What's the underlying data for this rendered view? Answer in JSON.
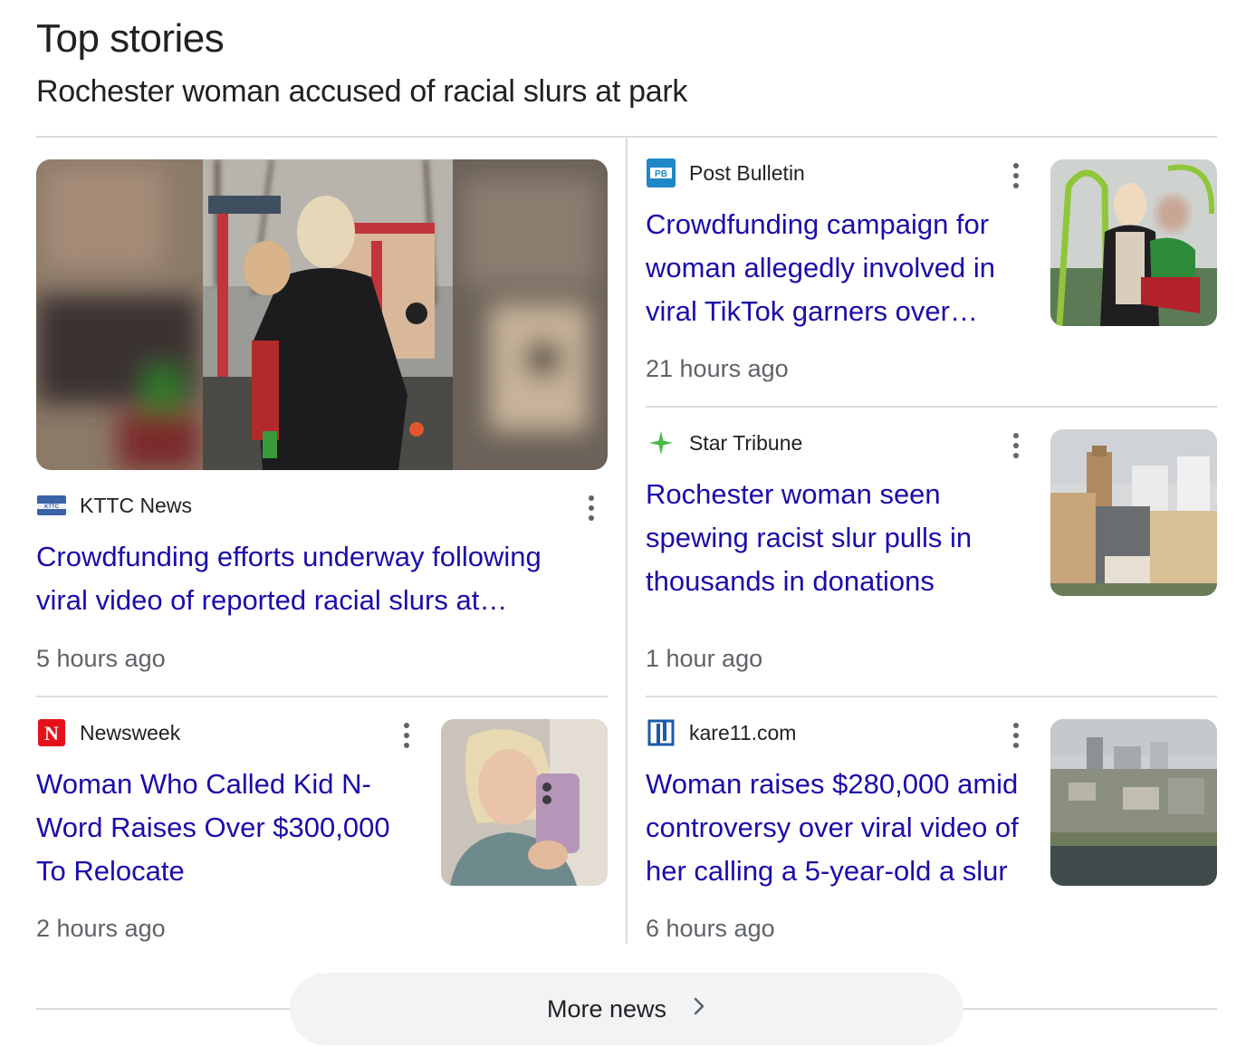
{
  "section": {
    "title": "Top stories",
    "subtitle": "Rochester woman accused of racial slurs at park"
  },
  "stories": [
    {
      "source": "KTTC News",
      "source_logo": "kttc-logo",
      "headline": "Crowdfunding efforts underway following viral video of reported racial slurs at…",
      "time": "5 hours ago",
      "image": "playground-woman-carrying-child"
    },
    {
      "source": "Post Bulletin",
      "source_logo": "pb-logo",
      "logo_text": "PB",
      "headline": "Crowdfunding campaign for woman allegedly involved in viral TikTok garners over…",
      "time": "21 hours ago",
      "image": "woman-holding-child-at-playground"
    },
    {
      "source": "Star Tribune",
      "source_logo": "star-tribune-logo",
      "headline": "Rochester woman seen spewing racist slur pulls in thousands in donations",
      "time": "1 hour ago",
      "image": "rochester-city-aerial"
    },
    {
      "source": "Newsweek",
      "source_logo": "newsweek-logo",
      "logo_text": "N",
      "headline": "Woman Who Called Kid N-Word Raises Over $300,000 To Relocate",
      "time": "2 hours ago",
      "image": "woman-mirror-selfie"
    },
    {
      "source": "kare11.com",
      "source_logo": "kare11-logo",
      "headline": "Woman raises $280,000 amid controversy over viral video of her calling a 5-year-old a slur",
      "time": "6 hours ago",
      "image": "rochester-skyline-river"
    }
  ],
  "more_button": {
    "label": "More news",
    "icon": "chevron-right-icon"
  },
  "colors": {
    "link": "#1a0dab",
    "meta": "#5f6368",
    "divider": "#dadce0",
    "button_bg": "#f1f3f4"
  }
}
